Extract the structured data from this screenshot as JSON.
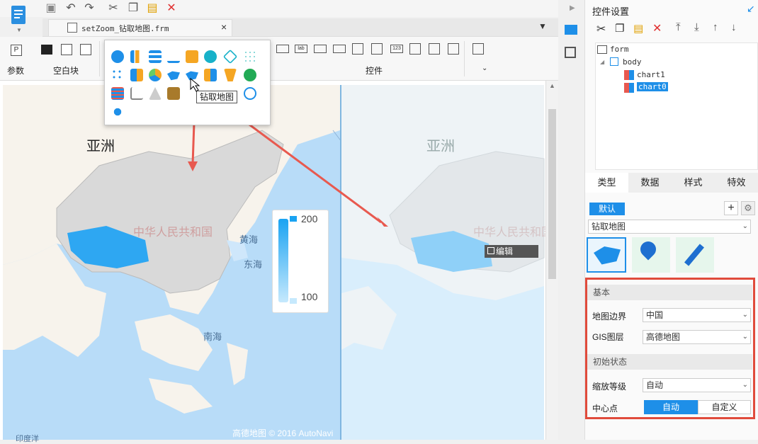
{
  "toolbar": {
    "quick_icons": [
      "save-icon",
      "undo-icon",
      "redo-icon",
      "cut-icon",
      "copy-icon",
      "paste-icon",
      "delete-icon"
    ]
  },
  "tab": {
    "filename": "setZoom_钻取地图.frm",
    "close": "×"
  },
  "ribbon": {
    "param_label": "参数",
    "blank_label": "空白块",
    "controls_label": "控件"
  },
  "popup": {
    "tooltip": "钻取地图"
  },
  "map_left": {
    "asia": "亚洲",
    "china": "中华人民共和国",
    "yellow_sea": "黄海",
    "east_sea": "东海",
    "south_sea": "南海",
    "attribution": "高德地图 © 2016 AutoNavi",
    "ocean": "印度洋"
  },
  "legend": {
    "max": "200",
    "min": "100"
  },
  "map_right": {
    "asia": "亚洲",
    "china": "中华人民共和国",
    "edit": "编辑"
  },
  "panel": {
    "title": "控件设置",
    "tree": {
      "form": "form",
      "body": "body",
      "chart1": "chart1",
      "chart0": "chart0"
    },
    "tabs": [
      "类型",
      "数据",
      "样式",
      "特效"
    ],
    "default_btn": "默认",
    "chart_type": "钻取地图",
    "basic_section": "基本",
    "map_border_label": "地图边界",
    "map_border_value": "中国",
    "gis_label": "GIS图层",
    "gis_value": "高德地图",
    "init_section": "初始状态",
    "zoom_label": "缩放等级",
    "zoom_value": "自动",
    "center_label": "中心点",
    "center_auto": "自动",
    "center_custom": "自定义"
  }
}
